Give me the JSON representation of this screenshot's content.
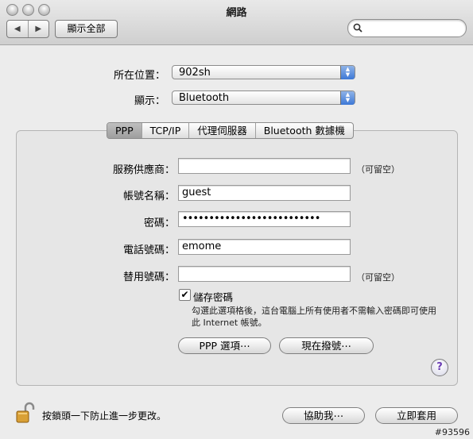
{
  "window": {
    "title": "網路"
  },
  "toolbar": {
    "show_all_label": "顯示全部",
    "back_glyph": "◀",
    "forward_glyph": "▶",
    "search_placeholder": ""
  },
  "location": {
    "label": "所在位置：",
    "value": "902sh"
  },
  "show": {
    "label": "顯示：",
    "value": "Bluetooth"
  },
  "tabs": [
    {
      "label": "PPP",
      "active": true
    },
    {
      "label": "TCP/IP",
      "active": false
    },
    {
      "label": "代理伺服器",
      "active": false
    },
    {
      "label": "Bluetooth 數據機",
      "active": false
    }
  ],
  "form": {
    "provider": {
      "label": "服務供應商：",
      "value": "",
      "hint": "（可留空）"
    },
    "account": {
      "label": "帳號名稱：",
      "value": "guest"
    },
    "password": {
      "label": "密碼：",
      "value": "••••••••••••••••••••••••••"
    },
    "phone": {
      "label": "電話號碼：",
      "value": "emome"
    },
    "alt_phone": {
      "label": "替用號碼：",
      "value": "",
      "hint": "（可留空）"
    }
  },
  "save_password": {
    "checked": true,
    "label": "儲存密碼",
    "note_line1": "勾選此選項格後，這台電腦上所有使用者不需輸入密碼即可使用",
    "note_line2": "此 Internet 帳號。"
  },
  "buttons": {
    "ppp_options": "PPP 選項⋯",
    "dial_now": "現在撥號⋯",
    "assist": "協助我⋯",
    "apply_now": "立即套用",
    "help": "?"
  },
  "footer": {
    "lock_text": "按鎖頭一下防止進一步更改。",
    "watermark": "#93596"
  }
}
